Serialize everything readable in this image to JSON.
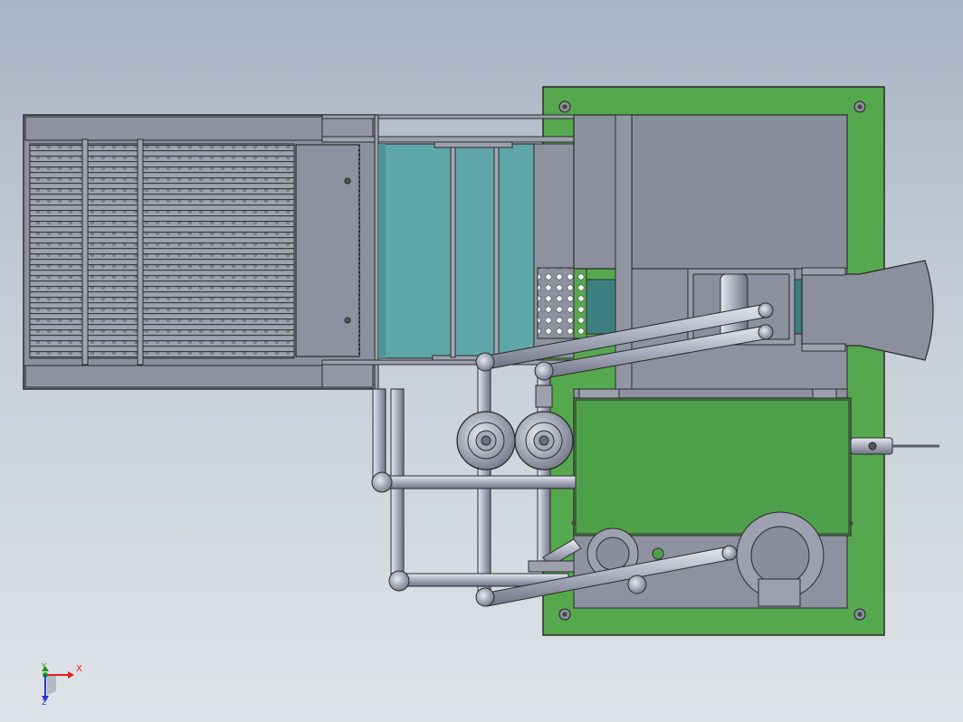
{
  "view": {
    "colors": {
      "background_top": "#a8b3c4",
      "background_bottom": "#dfe3e8",
      "base_plate": "#55a84e",
      "machine_body": "#8c8f9e",
      "water_tank": "#5fa6a9",
      "tank_deep": "#3d7f80",
      "pipe": "#b4b8c8",
      "outline": "#2b2b2b"
    },
    "icons": [
      "x-axis-arrow-icon",
      "y-axis-arrow-icon",
      "z-axis-arrow-icon"
    ]
  },
  "triad": {
    "x": "X",
    "y": "Y",
    "z": "Z"
  }
}
